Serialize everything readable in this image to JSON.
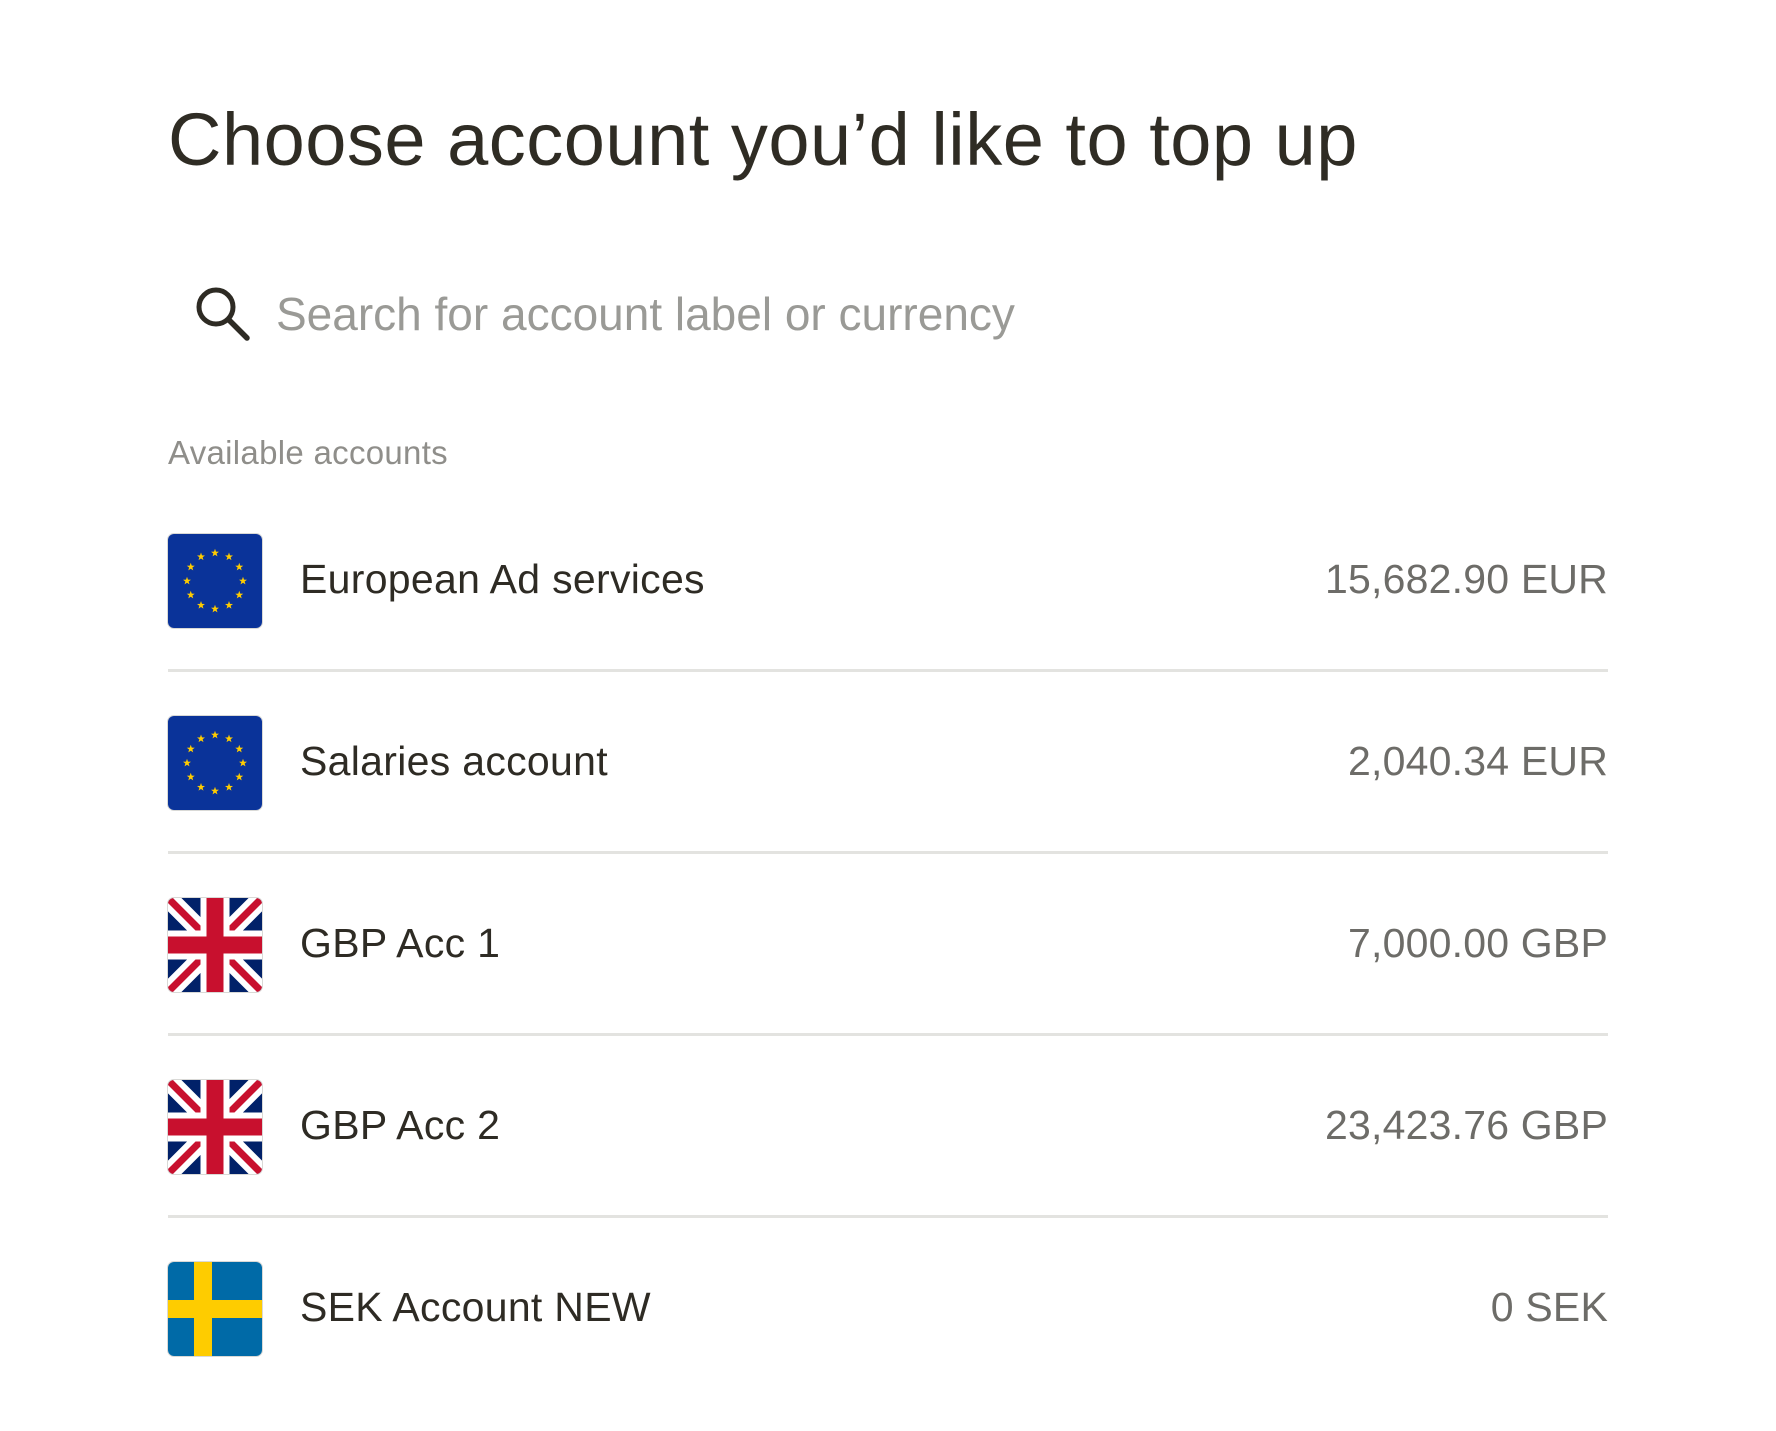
{
  "page": {
    "title": "Choose account you’d like to top up"
  },
  "search": {
    "placeholder": "Search for account label or currency",
    "value": "",
    "icon": "search-icon"
  },
  "section": {
    "label": "Available accounts"
  },
  "accounts": [
    {
      "name": "European Ad services",
      "balance": "15,682.90 EUR",
      "flag": "eu-flag-icon"
    },
    {
      "name": "Salaries account",
      "balance": "2,040.34 EUR",
      "flag": "eu-flag-icon"
    },
    {
      "name": "GBP Acc 1",
      "balance": "7,000.00 GBP",
      "flag": "uk-flag-icon"
    },
    {
      "name": "GBP Acc 2",
      "balance": "23,423.76 GBP",
      "flag": "uk-flag-icon"
    },
    {
      "name": "SEK Account NEW",
      "balance": "0 SEK",
      "flag": "sweden-flag-icon"
    }
  ],
  "colors": {
    "text_primary": "#2e2b24",
    "text_secondary": "#8f8e8a",
    "divider": "#e3e3e0",
    "eu_blue": "#0a3399",
    "eu_gold": "#ffcc00",
    "uk_blue": "#012169",
    "uk_red": "#c8102e",
    "se_blue": "#006aa7",
    "se_yellow": "#fecc00"
  }
}
